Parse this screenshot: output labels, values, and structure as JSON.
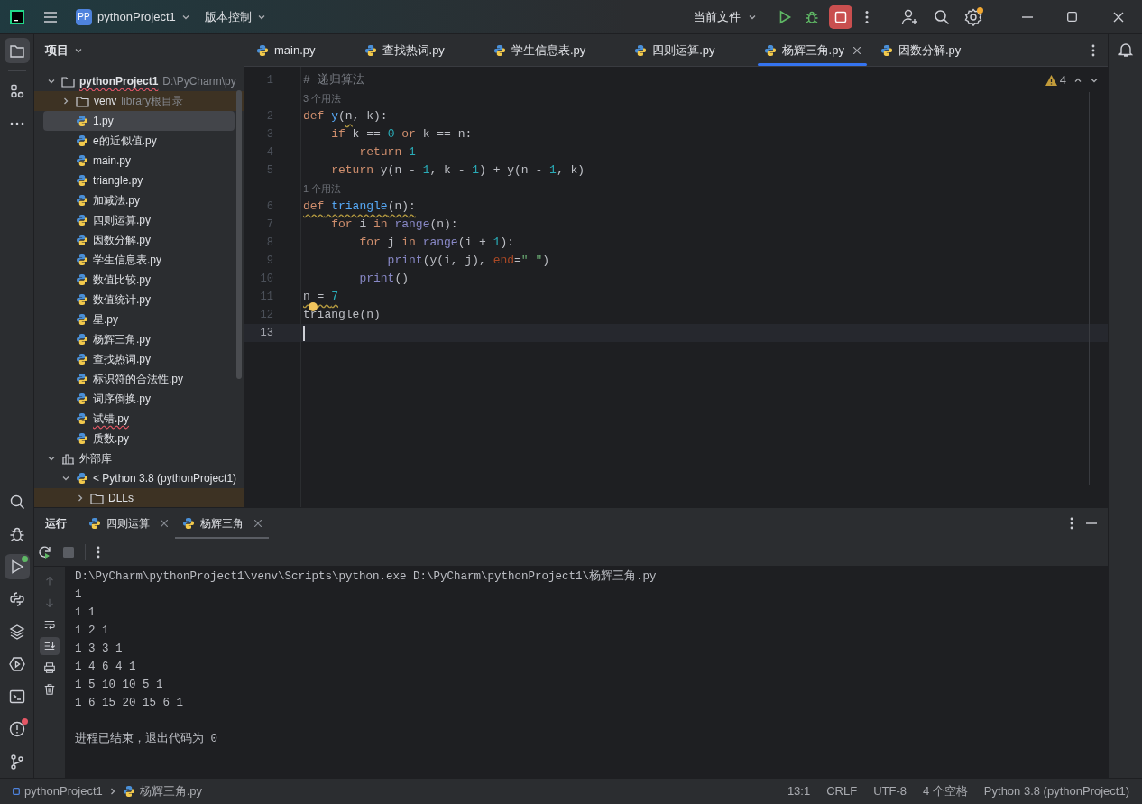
{
  "title_bar": {
    "project_badge": "PP",
    "project": "pythonProject1",
    "vcs": "版本控制",
    "run_config": "当前文件",
    "settings_badge": true
  },
  "left_toolbar": {
    "top": [
      {
        "selected": true
      },
      {
        "selected": false
      },
      {
        "selected": false
      }
    ],
    "bottom": [
      {
        "selected": false
      },
      {
        "selected": false
      },
      {
        "selected": true,
        "color": "#5fb865"
      },
      {
        "selected": false
      },
      {
        "selected": false
      },
      {
        "selected": false
      },
      {
        "selected": false
      },
      {
        "selected": false,
        "color": "#e55765"
      },
      {
        "selected": false
      }
    ]
  },
  "project_panel": {
    "title": "项目",
    "tree": [
      {
        "label": "pythonProject1",
        "note": "D:\\PyCharm\\py",
        "kind": "project",
        "expanded": true,
        "error": true,
        "selected": false,
        "children": [
          {
            "label": "venv",
            "note": "library根目录",
            "kind": "excluded",
            "expanded": false,
            "error": false,
            "selected": false
          },
          {
            "label": "1.py",
            "kind": "file",
            "error": false,
            "selected": true
          },
          {
            "label": "e的近似值.py",
            "kind": "file",
            "error": false,
            "selected": false
          },
          {
            "label": "main.py",
            "kind": "file",
            "error": false,
            "selected": false
          },
          {
            "label": "triangle.py",
            "kind": "file",
            "error": false,
            "selected": false
          },
          {
            "label": "加减法.py",
            "kind": "file",
            "error": false,
            "selected": false
          },
          {
            "label": "四则运算.py",
            "kind": "file",
            "error": false,
            "selected": false
          },
          {
            "label": "因数分解.py",
            "kind": "file",
            "error": false,
            "selected": false
          },
          {
            "label": "学生信息表.py",
            "kind": "file",
            "error": false,
            "selected": false
          },
          {
            "label": "数值比较.py",
            "kind": "file",
            "error": false,
            "selected": false
          },
          {
            "label": "数值统计.py",
            "kind": "file",
            "error": false,
            "selected": false
          },
          {
            "label": "星.py",
            "kind": "file",
            "error": false,
            "selected": false
          },
          {
            "label": "杨辉三角.py",
            "kind": "file",
            "error": false,
            "selected": false
          },
          {
            "label": "查找热词.py",
            "kind": "file",
            "error": false,
            "selected": false
          },
          {
            "label": "标识符的合法性.py",
            "kind": "file",
            "error": false,
            "selected": false
          },
          {
            "label": "词序倒换.py",
            "kind": "file",
            "error": false,
            "selected": false
          },
          {
            "label": "试错.py",
            "kind": "file",
            "error": true,
            "selected": false
          },
          {
            "label": "质数.py",
            "kind": "file",
            "error": false,
            "selected": false
          }
        ]
      },
      {
        "label": "外部库",
        "kind": "library",
        "expanded": true,
        "error": false,
        "selected": false,
        "children": [
          {
            "label": "< Python 3.8 (pythonProject1)",
            "kind": "sdk",
            "expanded": true,
            "error": false,
            "selected": false,
            "children": [
              {
                "label": "DLLs",
                "kind": "excluded",
                "expanded": false,
                "error": false,
                "selected": false
              }
            ]
          }
        ]
      }
    ]
  },
  "editor": {
    "tabs": [
      {
        "label": "main.py",
        "selected": false
      },
      {
        "label": "查找热词.py",
        "selected": false
      },
      {
        "label": "学生信息表.py",
        "selected": false
      },
      {
        "label": "四则运算.py",
        "selected": false
      },
      {
        "label": "杨辉三角.py",
        "selected": true
      },
      {
        "label": "因数分解.py",
        "selected": false
      }
    ],
    "warnings": "4",
    "lines": [
      {
        "kind": "code",
        "number": "1",
        "current": false,
        "tokens": [
          {
            "text": "# 递归算法",
            "kind": "comment"
          }
        ]
      },
      {
        "kind": "hint",
        "text": "3 个用法"
      },
      {
        "kind": "code",
        "number": "2",
        "current": false,
        "tokens": [
          {
            "text": "def",
            "kind": "keyword",
            "underline": false
          },
          {
            "text": " y",
            "kind": "func",
            "underline": false
          },
          {
            "text": "(",
            "kind": "plain",
            "underline": false
          },
          {
            "text": "n",
            "kind": "plain",
            "underline": true
          },
          {
            "text": ", k):",
            "kind": "plain",
            "underline": false
          }
        ]
      },
      {
        "kind": "code",
        "number": "3",
        "current": false,
        "tokens": [
          {
            "text": "    if",
            "kind": "keyword"
          },
          {
            "text": " k == ",
            "kind": "plain"
          },
          {
            "text": "0",
            "kind": "number"
          },
          {
            "text": " or",
            "kind": "keyword"
          },
          {
            "text": " k == n:",
            "kind": "plain"
          }
        ]
      },
      {
        "kind": "code",
        "number": "4",
        "current": false,
        "tokens": [
          {
            "text": "        return",
            "kind": "keyword"
          },
          {
            "text": " 1",
            "kind": "number"
          }
        ]
      },
      {
        "kind": "code",
        "number": "5",
        "current": false,
        "tokens": [
          {
            "text": "    return",
            "kind": "keyword"
          },
          {
            "text": " y(n - ",
            "kind": "plain"
          },
          {
            "text": "1",
            "kind": "number"
          },
          {
            "text": ", k - ",
            "kind": "plain"
          },
          {
            "text": "1",
            "kind": "number"
          },
          {
            "text": ") + y(n - ",
            "kind": "plain"
          },
          {
            "text": "1",
            "kind": "number"
          },
          {
            "text": ", k)",
            "kind": "plain"
          }
        ]
      },
      {
        "kind": "hint",
        "text": "1 个用法"
      },
      {
        "kind": "code",
        "number": "6",
        "current": false,
        "tokens": [
          {
            "text": "def",
            "kind": "keyword",
            "underline": true
          },
          {
            "text": " triangle",
            "kind": "func",
            "underline": true
          },
          {
            "text": "(n):",
            "kind": "plain",
            "underline": true
          }
        ]
      },
      {
        "kind": "code",
        "number": "7",
        "current": false,
        "tokens": [
          {
            "text": "    for",
            "kind": "keyword"
          },
          {
            "text": " i ",
            "kind": "plain"
          },
          {
            "text": "in",
            "kind": "keyword"
          },
          {
            "text": " range",
            "kind": "builtin"
          },
          {
            "text": "(n):",
            "kind": "plain"
          }
        ]
      },
      {
        "kind": "code",
        "number": "8",
        "current": false,
        "tokens": [
          {
            "text": "        for",
            "kind": "keyword"
          },
          {
            "text": " j ",
            "kind": "plain"
          },
          {
            "text": "in",
            "kind": "keyword"
          },
          {
            "text": " range",
            "kind": "builtin"
          },
          {
            "text": "(i + ",
            "kind": "plain"
          },
          {
            "text": "1",
            "kind": "number"
          },
          {
            "text": "):",
            "kind": "plain"
          }
        ]
      },
      {
        "kind": "code",
        "number": "9",
        "current": false,
        "tokens": [
          {
            "text": "            print",
            "kind": "builtin"
          },
          {
            "text": "(y(i, j), ",
            "kind": "plain"
          },
          {
            "text": "end",
            "kind": "named"
          },
          {
            "text": "=",
            "kind": "plain"
          },
          {
            "text": "\" \"",
            "kind": "string"
          },
          {
            "text": ")",
            "kind": "plain"
          }
        ]
      },
      {
        "kind": "code",
        "number": "10",
        "current": false,
        "tokens": [
          {
            "text": "        print",
            "kind": "builtin"
          },
          {
            "text": "()",
            "kind": "plain"
          }
        ]
      },
      {
        "kind": "code",
        "number": "11",
        "current": false,
        "tokens": [
          {
            "text": "n = ",
            "kind": "plain",
            "underline": true
          },
          {
            "text": "7",
            "kind": "number",
            "underline": true
          }
        ]
      },
      {
        "kind": "code",
        "number": "12",
        "current": false,
        "bulb": true,
        "tokens": [
          {
            "text": "triangle(n)",
            "kind": "plain"
          }
        ]
      },
      {
        "kind": "code",
        "number": "13",
        "current": true
      }
    ]
  },
  "run_panel": {
    "title": "运行",
    "tabs": [
      {
        "label": "四则运算",
        "selected": false
      },
      {
        "label": "杨辉三角",
        "selected": true
      }
    ],
    "side_tools": [
      {
        "disabled": true,
        "selected": false
      },
      {
        "disabled": true,
        "selected": false
      },
      {
        "disabled": false,
        "selected": false
      },
      {
        "disabled": false,
        "selected": true
      },
      {
        "disabled": false,
        "selected": false
      },
      {
        "disabled": false,
        "selected": false
      }
    ],
    "console": [
      "D:\\PyCharm\\pythonProject1\\venv\\Scripts\\python.exe D:\\PyCharm\\pythonProject1\\杨辉三角.py",
      "1",
      "1 1",
      "1 2 1",
      "1 3 3 1",
      "1 4 6 4 1",
      "1 5 10 10 5 1",
      "1 6 15 20 15 6 1"
    ],
    "exit_message": "进程已结束，退出代码为 0"
  },
  "status_bar": {
    "breadcrumb": [
      "pythonProject1",
      "杨辉三角.py"
    ],
    "items": [
      "13:1",
      "CRLF",
      "UTF-8",
      "4 个空格",
      "Python 3.8 (pythonProject1)"
    ]
  }
}
